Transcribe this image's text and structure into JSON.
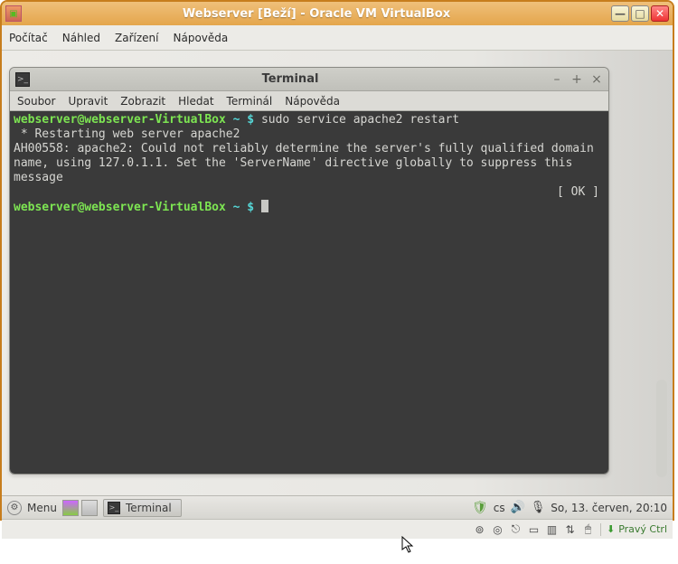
{
  "vbox": {
    "title": "Webserver [Beží] - Oracle VM VirtualBox",
    "menu": {
      "m1": "Počítač",
      "m2": "Náhled",
      "m3": "Zařízení",
      "m4": "Nápověda"
    },
    "winbtn": {
      "min": "—",
      "max": "□",
      "close": "✕"
    },
    "hostkey": "Pravý Ctrl"
  },
  "terminal": {
    "title": "Terminal",
    "menu": {
      "m1": "Soubor",
      "m2": "Upravit",
      "m3": "Zobrazit",
      "m4": "Hledat",
      "m5": "Terminál",
      "m6": "Nápověda"
    },
    "winbtn": {
      "min": "–",
      "max": "+",
      "close": "×"
    },
    "prompt_user": "webserver@webserver-VirtualBox",
    "prompt_sep": " ~ $",
    "cmd1": "sudo service apache2 restart",
    "out1": " * Restarting web server apache2",
    "out2": "AH00558: apache2: Could not reliably determine the server's fully qualified domain name, using 127.0.1.1. Set the 'ServerName' directive globally to suppress this message",
    "ok": "[ OK ]"
  },
  "taskbar": {
    "menu": "Menu",
    "task1": "Terminal",
    "lang": "cs",
    "clock": "So, 13. červen, 20:10"
  }
}
